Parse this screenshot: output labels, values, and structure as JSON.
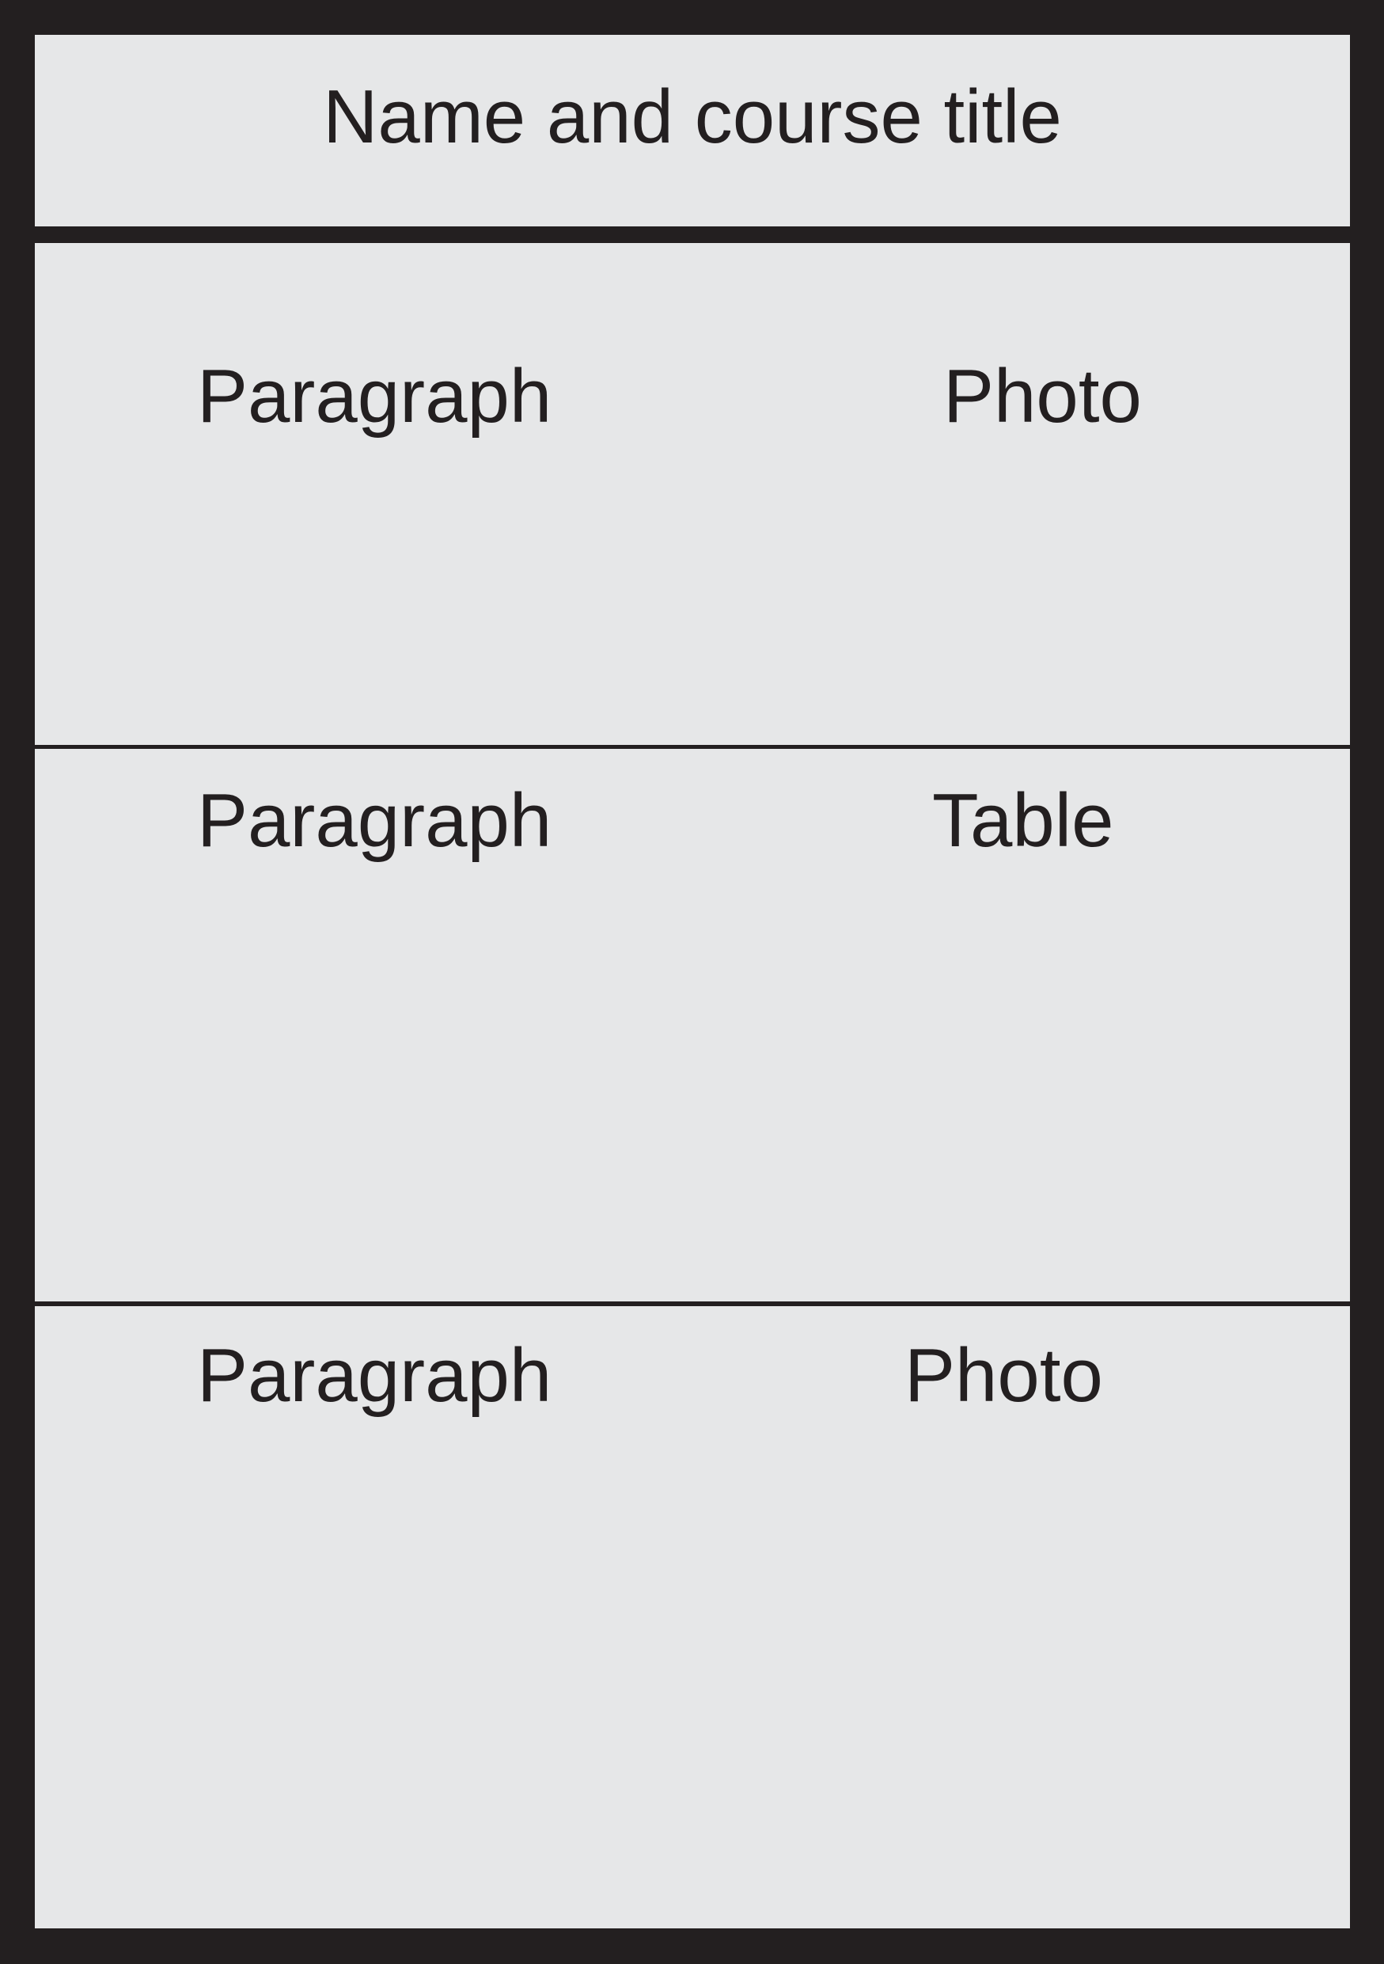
{
  "title": "Name and course title",
  "sections": [
    {
      "left_label": "Paragraph",
      "right_label": "Photo"
    },
    {
      "left_label": "Paragraph",
      "right_label": "Table"
    },
    {
      "left_label": "Paragraph",
      "right_label": "Photo"
    }
  ],
  "colors": {
    "frame": "#231f20",
    "panel": "#e6e7e8",
    "text": "#231f20"
  }
}
